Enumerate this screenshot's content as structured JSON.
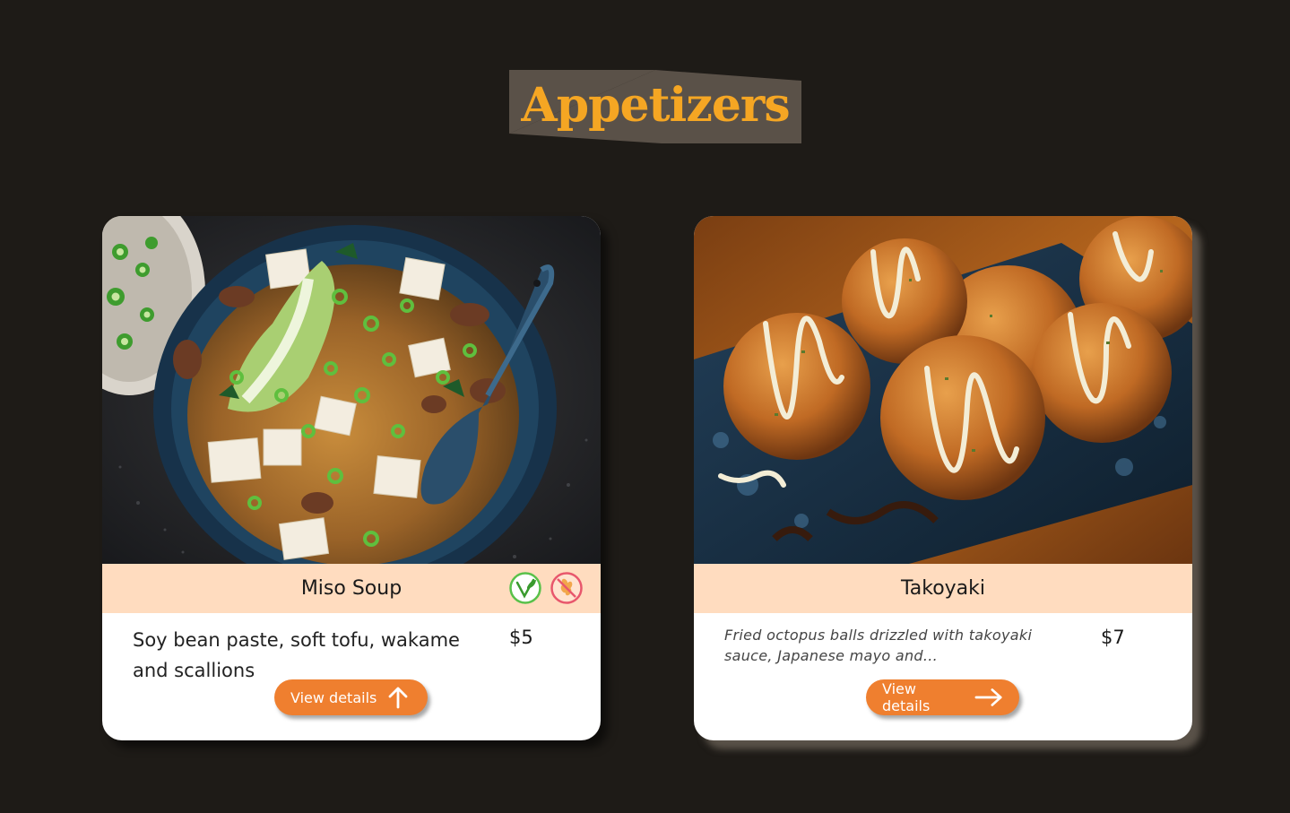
{
  "section": {
    "title": "Appetizers",
    "title_color": "#f5a623",
    "title_bg_color": "#5a5148"
  },
  "colors": {
    "background": "#1e1b17",
    "card_bg": "#ffffff",
    "name_bar": "#ffdcbf",
    "button": "#ef7f2f"
  },
  "items": [
    {
      "name": "Miso Soup",
      "description": "Soy bean paste, soft tofu, wakame and scallions",
      "price": "$5",
      "button_label": "View details",
      "button_icon": "arrow-up-icon",
      "image": "miso-soup-photo",
      "diet_icons": [
        "vegan-leaf-icon",
        "no-gluten-icon"
      ]
    },
    {
      "name": "Takoyaki",
      "description": "Fried octopus balls drizzled with takoyaki sauce, Japanese mayo and...",
      "price": "$7",
      "button_label": "View details",
      "button_icon": "arrow-right-icon",
      "image": "takoyaki-photo",
      "diet_icons": []
    }
  ]
}
